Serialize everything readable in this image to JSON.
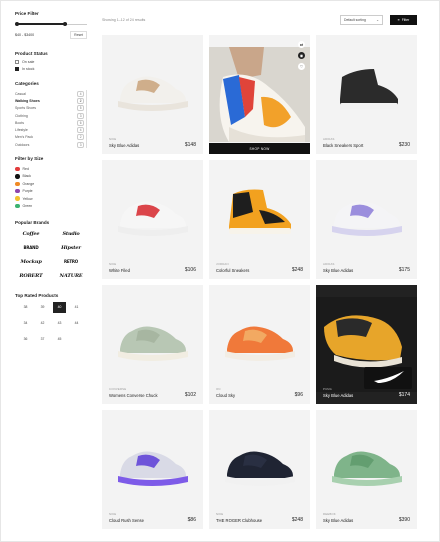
{
  "sidebar": {
    "price_filter": {
      "title": "Price Filter",
      "range_text": "$40 - $3400",
      "reset_label": "Reset"
    },
    "product_status": {
      "title": "Product Status",
      "items": [
        {
          "label": "On sale",
          "checked": false
        },
        {
          "label": "In stock",
          "checked": true
        }
      ]
    },
    "categories": {
      "title": "Categories",
      "items": [
        {
          "label": "Casual",
          "count": "4",
          "selected": false
        },
        {
          "label": "Walking Shoes",
          "count": "2",
          "selected": true
        },
        {
          "label": "Sports Shoes",
          "count": "5",
          "selected": false
        },
        {
          "label": "Clothing",
          "count": "3",
          "selected": false
        },
        {
          "label": "Boots",
          "count": "6",
          "selected": false
        },
        {
          "label": "Lifestyle",
          "count": "4",
          "selected": false
        },
        {
          "label": "Men's Pack",
          "count": "2",
          "selected": false
        },
        {
          "label": "Outdoors",
          "count": "3",
          "selected": false
        }
      ]
    },
    "colors": {
      "title": "Filter by Size",
      "items": [
        {
          "label": "Red",
          "color": "#e23b3b"
        },
        {
          "label": "Black",
          "color": "#111111"
        },
        {
          "label": "Orange",
          "color": "#f08a24"
        },
        {
          "label": "Purple",
          "color": "#8e44ad"
        },
        {
          "label": "Yellow",
          "color": "#f2c230"
        },
        {
          "label": "Green",
          "color": "#3cb371"
        }
      ]
    },
    "brands": {
      "title": "Popular Brands",
      "items": [
        "Coffee",
        "Studio",
        "BRAND",
        "Hipster",
        "Mockup",
        "RETRO",
        "ROBERT",
        "NATURE"
      ]
    },
    "sizes": {
      "title": "Top Rated Products",
      "items": [
        {
          "label": "38",
          "selected": false
        },
        {
          "label": "39",
          "selected": false
        },
        {
          "label": "40",
          "selected": true
        },
        {
          "label": "41",
          "selected": false
        },
        {
          "label": "34",
          "selected": false
        },
        {
          "label": "42",
          "selected": false
        },
        {
          "label": "43",
          "selected": false
        },
        {
          "label": "44",
          "selected": false
        },
        {
          "label": "36",
          "selected": false
        },
        {
          "label": "37",
          "selected": false
        },
        {
          "label": "45",
          "selected": false
        }
      ]
    }
  },
  "toolbar": {
    "showing_text": "Showing 1–12 of 24 results",
    "sort_label": "Default sorting",
    "filter_label": "Filter"
  },
  "products": [
    {
      "brand": "Nike",
      "name": "Sky Blue Adidas",
      "price": "$148",
      "shoe": "white-tan",
      "colors": {
        "body": "#f2f0ec",
        "accent": "#c9a27a",
        "sole": "#e9e4dc"
      }
    },
    {
      "brand": "",
      "name": "",
      "price": "",
      "shoe": "hero",
      "shop_label": "SHOP NOW",
      "colors": {
        "body": "#f7f4ee",
        "accent": "#f2a12a",
        "sole": "#e6e1d8"
      }
    },
    {
      "brand": "Adidas",
      "name": "Black Sneakers Sport",
      "price": "$230",
      "shoe": "black-high",
      "colors": {
        "body": "#2b2b2b",
        "accent": "#1a1a1a",
        "sole": "#f2f2f2"
      }
    },
    {
      "brand": "Nike",
      "name": "White Filed",
      "price": "$106",
      "shoe": "white-red",
      "colors": {
        "body": "#f6f6f6",
        "accent": "#d6262b",
        "sole": "#eeeeee"
      }
    },
    {
      "brand": "Jordan",
      "name": "Colorful Sneakers",
      "price": "$248",
      "shoe": "jordan",
      "colors": {
        "body": "#f2a11f",
        "accent": "#1e1e1e",
        "sole": "#f7f3ea"
      }
    },
    {
      "brand": "Adidas",
      "name": "Sky Blue Adidas",
      "price": "$175",
      "shoe": "on-white",
      "colors": {
        "body": "#f4f4f6",
        "accent": "#8b7bd8",
        "sole": "#d6d3ee"
      }
    },
    {
      "brand": "Converse",
      "name": "Womens Converse Chuck",
      "price": "$102",
      "shoe": "sage",
      "colors": {
        "body": "#b8c7b4",
        "accent": "#a3b39e",
        "sole": "#f1ede2"
      }
    },
    {
      "brand": "On",
      "name": "Cloud Sky",
      "price": "$96",
      "shoe": "orange",
      "colors": {
        "body": "#f0793a",
        "accent": "#f2b26a",
        "sole": "#f2ede4"
      }
    },
    {
      "brand": "Puma",
      "name": "Sky Blue Adidas",
      "price": "$174",
      "shoe": "dark-promo",
      "colors": {
        "body": "#e7a52a",
        "accent": "#1c1c1c",
        "sole": "#f0f0f0"
      }
    },
    {
      "brand": "Nike",
      "name": "Cloud Rush Sense",
      "price": "$86",
      "shoe": "purple",
      "colors": {
        "body": "#d9dae6",
        "accent": "#5b3cd6",
        "sole": "#7d5be8"
      }
    },
    {
      "brand": "Nike",
      "name": "THE ROGER Clubhouse",
      "price": "$248",
      "shoe": "navy",
      "colors": {
        "body": "#1f2433",
        "accent": "#2b3145",
        "sole": "#f1f1f1"
      }
    },
    {
      "brand": "Reebok",
      "name": "Sky Blue Adidas",
      "price": "$390",
      "shoe": "green",
      "colors": {
        "body": "#7fb48a",
        "accent": "#5e9a6b",
        "sole": "#a8d0af"
      }
    }
  ]
}
